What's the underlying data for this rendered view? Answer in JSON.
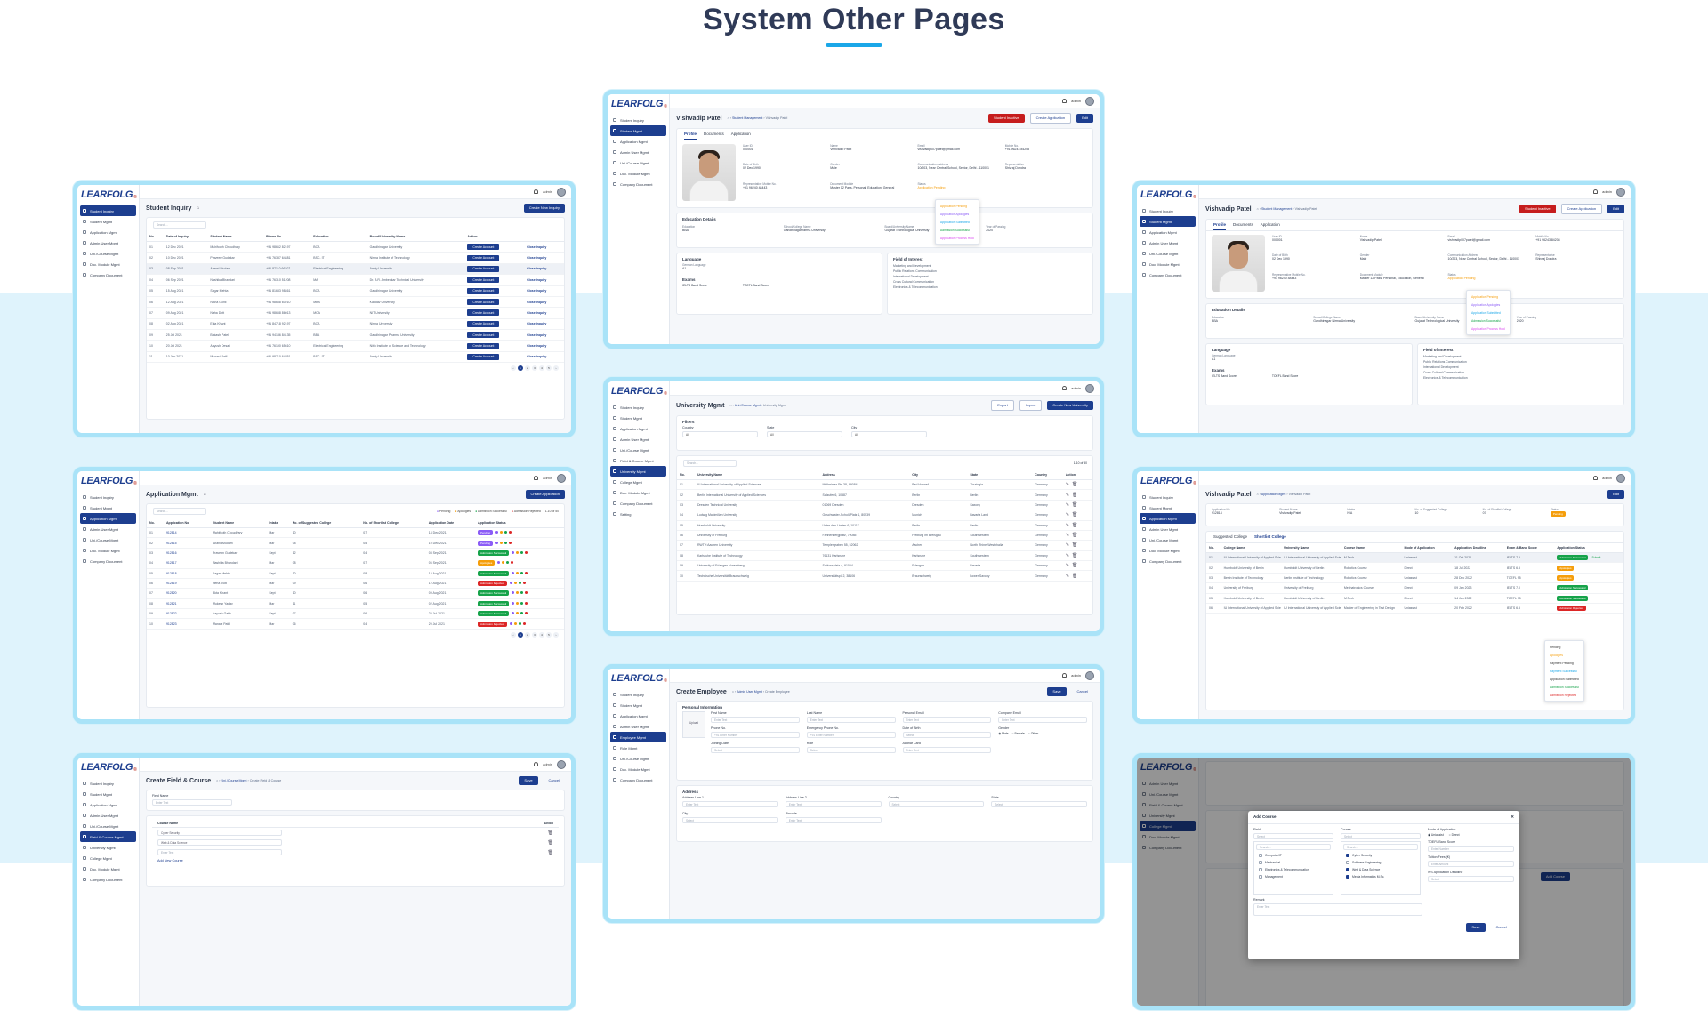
{
  "page": {
    "title": "System Other Pages",
    "accent": "#1aa7e8",
    "brand": "#1d3e8f"
  },
  "common": {
    "logo": "LEARFOLG",
    "admin": "admin",
    "save": "Save",
    "cancel": "Cancel",
    "edit": "Edit",
    "search": "Search...",
    "enter_text": "Enter Text",
    "select": "Select"
  },
  "nav_a": [
    "Student Inquiry",
    "Student Mgmt",
    "Application Mgmt",
    "Admin User Mgmt",
    "Uni./Course Mgmt",
    "Doc. Module Mgmt",
    "Company Document"
  ],
  "nav_b": [
    "Student Inquiry",
    "Student Mgmt",
    "Application Mgmt",
    "Admin User Mgmt",
    "Uni./Course Mgmt",
    "Field & Course Mgmt",
    "University Mgmt",
    "College Mgmt",
    "Doc. Module Mgmt",
    "Company Document",
    "Setting"
  ],
  "inquiry": {
    "title": "Student Inquiry",
    "create": "Create New Inquiry",
    "headers": [
      "No.",
      "Date of Inquiry",
      "Student Name",
      "Phone No.",
      "Education",
      "Board/University Name",
      "Action",
      ""
    ],
    "action_btn": "Create Account",
    "close": "Close Inquiry",
    "rows": [
      [
        "01",
        "12 Dec 2021",
        "Mahifooth Choudhary",
        "+91 98662 82197",
        "BCA",
        "Gandhinagar University"
      ],
      [
        "02",
        "10 Dec 2021",
        "Praveen Gudekar",
        "+91 76387 64481",
        "BSC- IT",
        "Nirma Institute of Technology"
      ],
      [
        "03",
        "08 Sep 2021",
        "Anand Mudam",
        "+91 87110 66207",
        "Electrical Engineering",
        "Amity University"
      ],
      [
        "04",
        "06 Sep 2021",
        "Nashika Bhandari",
        "+91 76310 51208",
        "MA",
        "Dr. B.R. Ambedkar Technical University"
      ],
      [
        "05",
        "15 Aug 2021",
        "Sagar Mehta",
        "+91 81683 98461",
        "BCA",
        "Gandhinagar University"
      ],
      [
        "06",
        "12 Aug 2021",
        "Nisha Gohil",
        "+91 98658 60210",
        "MBA",
        "Kaddav University"
      ],
      [
        "07",
        "09 Aug 2021",
        "Neha Dutt",
        "+91 98658 86013",
        "MCA",
        "NIT University"
      ],
      [
        "08",
        "02 Aug 2021",
        "Ekta Khant",
        "+91 84718 92197",
        "BCA",
        "Nirma University"
      ],
      [
        "09",
        "25 Jul 2021",
        "Bakash Patel",
        "+91 94136 84135",
        "BBA",
        "Gandhinagar Pharma University"
      ],
      [
        "10",
        "20 Jul 2021",
        "Aayush Desai",
        "+91 76190 65610",
        "Electrical Engineering",
        "Nitin Institute of Science and Technology"
      ],
      [
        "11",
        "10 Jun 2021",
        "Manasi Patil",
        "+91 98710 64251",
        "BSC- IT",
        "Amity University"
      ]
    ]
  },
  "appmgmt": {
    "title": "Application Mgmt",
    "create": "Create Application",
    "legend": [
      "Pending",
      "Apologies",
      "Admission Successful",
      "Admission Rejected"
    ],
    "page_label": "1-10 of 50",
    "headers": [
      "No.",
      "Application No.",
      "Student Name",
      "Intake",
      "No. of Suggested College",
      "No. of Shortlist College",
      "Application Date",
      "Application Status"
    ],
    "rows": [
      [
        "01",
        "912814",
        "Mahifooth Choudhary",
        "Mar",
        "10",
        "07",
        "14 Dec 2021",
        "Pending"
      ],
      [
        "02",
        "912815",
        "Anand Mudam",
        "Mar",
        "08",
        "05",
        "10 Dec 2021",
        "Pending"
      ],
      [
        "03",
        "912816",
        "Praveen Gudekar",
        "Sept",
        "12",
        "04",
        "08 Sep 2021",
        "Admission Successful"
      ],
      [
        "04",
        "912817",
        "Nashika Bhandari",
        "Mar",
        "08",
        "07",
        "06 Sep 2021",
        "Apologies"
      ],
      [
        "05",
        "912818",
        "Sagar Mehta",
        "Sept",
        "10",
        "08",
        "15 Aug 2021",
        "Admission Successful"
      ],
      [
        "06",
        "912819",
        "Neha Dutt",
        "Mar",
        "09",
        "06",
        "12 Aug 2021",
        "Admission Rejected"
      ],
      [
        "07",
        "912820",
        "Ekta Khant",
        "Sept",
        "10",
        "06",
        "09 Aug 2021",
        "Admission Successful"
      ],
      [
        "08",
        "912821",
        "Mukesh Yadav",
        "Mar",
        "11",
        "05",
        "02 Aug 2021",
        "Admission Successful"
      ],
      [
        "09",
        "912822",
        "Aayush Gattu",
        "Sept",
        "07",
        "06",
        "25 Jul 2021",
        "Admission Successful"
      ],
      [
        "10",
        "912823",
        "Manasi Patil",
        "Mar",
        "06",
        "04",
        "20 Jul 2021",
        "Admission Rejected"
      ]
    ]
  },
  "fieldcourse": {
    "title": "Create Field & Course",
    "crumb1": "Uni./Course Mgmt",
    "crumb2": "Create Field & Course",
    "field_label": "Field Name",
    "course_header": "Course Name",
    "action_header": "Action",
    "courses": [
      "Cyber Security",
      "Web & Data Science"
    ],
    "add_course": "Add New Course"
  },
  "profile": {
    "name": "Vishvadip Patel",
    "crumb1": "Student Management",
    "crumb2": "Vishvadip Patel",
    "inactive": "Student Inactive",
    "create_app": "Create Application",
    "tabs": [
      "Profile",
      "Documents",
      "Application"
    ],
    "fields": [
      [
        "User ID",
        "000001"
      ],
      [
        "Name",
        "Vishvadip Patel"
      ],
      [
        "Email",
        "vishvadip007patel@gmail.com"
      ],
      [
        "Mobile No.",
        "+91 96243 84208"
      ],
      [
        "Date of Birth",
        "02 Dec 1990"
      ],
      [
        "Gender",
        "Male"
      ],
      [
        "Communication Address",
        "10/203, Near Central School, Sector, Delhi - 110001"
      ],
      [
        "Representative",
        "Shivraj Dondra"
      ],
      [
        "Representative Mobile No.",
        "+91 96240 48443"
      ],
      [
        "Document Module",
        "Master 12 Pass, Personal, Education, General"
      ],
      [
        "Status",
        "Application Pending"
      ]
    ],
    "status_opts": [
      "Application Pending",
      "Application Apologies",
      "Application Submitted",
      "Admission Successful",
      "Application Process Hold"
    ],
    "edu_title": "Education Details",
    "edu_cols": [
      "Education",
      "School/College Name",
      "Board/University Name",
      "Year of Passing"
    ],
    "edu_vals": [
      "BBA",
      "Gandhinagar Nirma University",
      "Gujarat Technological University",
      "2020"
    ],
    "lang_title": "Language",
    "lang_label": "German Language",
    "lang_val": "A1",
    "interest_title": "Field of Interest",
    "interests": [
      "Marketing and Development",
      "Public Relations Communication",
      "International Development",
      "Cross Cultural Communication",
      "Electronics & Telecommunication"
    ],
    "exams_title": "Exams",
    "exams": [
      "IELTS Band Score",
      "TOEFL Band Score"
    ]
  },
  "university": {
    "title": "University Mgmt",
    "crumb1": "Uni./Course Mgmt",
    "crumb2": "University Mgmt",
    "export": "Export",
    "import": "Import",
    "create": "Create New University",
    "filters": "Filters",
    "filter_labels": [
      "Country",
      "State",
      "City"
    ],
    "filter_vals": [
      "All",
      "All",
      "All"
    ],
    "page_label": "1-10 of 50",
    "headers": [
      "No.",
      "University Name",
      "Address",
      "City",
      "State",
      "Country",
      "Action"
    ],
    "rows": [
      [
        "01",
        "IU International University of Applied Sciences",
        "Mülheimer Str. 38, 99084",
        "Bad Honnef",
        "Thuringia",
        "Germany"
      ],
      [
        "02",
        "Berlin International University of Applied Sciences",
        "Salzufer 6, 10587",
        "Berlin",
        "Berlin",
        "Germany"
      ],
      [
        "03",
        "Dresden Technical University",
        "01069 Dresden",
        "Dresden",
        "Saxony",
        "Germany"
      ],
      [
        "04",
        "Ludwig Maximilian University",
        "Geschwister-Scholl-Platz 1, 80539",
        "Munich",
        "Bavaria Land",
        "Germany"
      ],
      [
        "05",
        "Humboldt University",
        "Unter den Linden 6, 10117",
        "Berlin",
        "Berlin",
        "Germany"
      ],
      [
        "06",
        "University of Freiburg",
        "Fahnenbergplatz, 79085",
        "Freiburg im Breisgau",
        "Southwestern",
        "Germany"
      ],
      [
        "07",
        "RWTH Aachen University",
        "Templergraben 55, 52062",
        "Aachen",
        "North Rhine-Westphalia",
        "Germany"
      ],
      [
        "08",
        "Karlsruhe Institute of Technology",
        "76131 Karlsruhe",
        "Karlsruhe",
        "Southwestern",
        "Germany"
      ],
      [
        "09",
        "University of Erlangen Nuremberg",
        "Schlossplatz 4, 91054",
        "Erlangen",
        "Bavaria",
        "Germany"
      ],
      [
        "10",
        "Technische Universität Braunschweig",
        "Universitätspl. 2, 38106",
        "Braunschweig",
        "Lower Saxony",
        "Germany"
      ]
    ]
  },
  "employee": {
    "title": "Create Employee",
    "crumb1": "Admin User Mgmt",
    "crumb2": "Create Employee",
    "personal": "Personal Information",
    "upload": "Upload",
    "labels": [
      "First Name",
      "Last Name",
      "Personal Email",
      "Company Email",
      "Phone No.",
      "Emergency Phone No.",
      "Date of Birth",
      "Gender",
      "Joining Date",
      "Role",
      "Aadhar Card"
    ],
    "phone_ph": "+91  Enter Number",
    "gender_opts": [
      "Male",
      "Female",
      "Other"
    ],
    "address": "Address",
    "addr_labels": [
      "Address Line 1",
      "Address Line 2",
      "Country",
      "State",
      "City",
      "Pincode"
    ]
  },
  "appdetail": {
    "name": "Vishvadip Patel",
    "crumb1": "Application Mgmt",
    "crumb2": "Vishvadip Patel",
    "info_labels": [
      "Application No.",
      "Student Name",
      "Intake",
      "No. of Suggested College",
      "No. of Shortlist College",
      "Status"
    ],
    "info_vals": [
      "912814",
      "Vishvadip Patel",
      "N/A",
      "10",
      "07",
      "Pending"
    ],
    "tabs": [
      "Suggested College",
      "Shortlist College"
    ],
    "headers": [
      "No.",
      "College Name",
      "University Name",
      "Course Name",
      "Mode of Application",
      "Application Deadline",
      "Exam & Band Score",
      "Application Status"
    ],
    "rows": [
      [
        "01",
        "IU International University of Applied Sciences",
        "IU International University of Applied Sciences",
        "M.Tech",
        "Uniassist",
        "11 Oct 2022",
        "IELTS 7.5",
        "Admission Successful"
      ],
      [
        "02",
        "Humboldt University of Berlin",
        "Humboldt University of Berlin",
        "Robotics Course",
        "Direct",
        "18 Jul 2022",
        "IELTS 6.5",
        "Apologies"
      ],
      [
        "03",
        "Berlin Institute of Technology",
        "Berlin Institute of Technology",
        "Robotics Course",
        "Uniassist",
        "28 Dec 2022",
        "TOEFL 95",
        "Apologies"
      ],
      [
        "04",
        "University of Freiburg",
        "University of Freiburg",
        "Mechatronics Course",
        "Direct",
        "09 Jan 2023",
        "IELTS 7.0",
        "Admission Successful"
      ],
      [
        "05",
        "Humboldt University of Berlin",
        "Humboldt University of Berlin",
        "M.Tech",
        "Direct",
        "14 Jan 2022",
        "TOEFL 95",
        "Admission Successful"
      ],
      [
        "06",
        "IU International University of Applied Sciences",
        "IU International University of Applied Sciences",
        "Master of Engineering in Test Design",
        "Uniassist",
        "20 Feb 2022",
        "IELTS 6.5",
        "Admission Rejected"
      ]
    ],
    "menu": [
      "Pending",
      "Apologies",
      "Payment Pending",
      "Payment Successful",
      "Application Submitted",
      "Admission Successful",
      "Admission Rejected"
    ],
    "submit": "Submit"
  },
  "addcourse": {
    "title": "Add Course",
    "field": "Field",
    "course": "Course",
    "mode": "Mode of Application",
    "mode_opts": [
      "Uniassist",
      "Direct"
    ],
    "fields": [
      "Computer/IT",
      "Mechanical",
      "Electronics & Telecommunication",
      "Management"
    ],
    "courses": [
      "Cyber Security",
      "Software Engineering",
      "Web & Data Science",
      "Media Informatics M.Sc."
    ],
    "courses_checked": [
      true,
      false,
      true,
      true
    ],
    "toefl": "TOEFL Band Score",
    "toefl_ph": "Enter Number",
    "fees": "Tuition Fees (€)",
    "fees_ph": "Enter Amount",
    "deadline": "WS Application Deadline",
    "remark": "Remark",
    "add_course_btn": "Add Course"
  }
}
